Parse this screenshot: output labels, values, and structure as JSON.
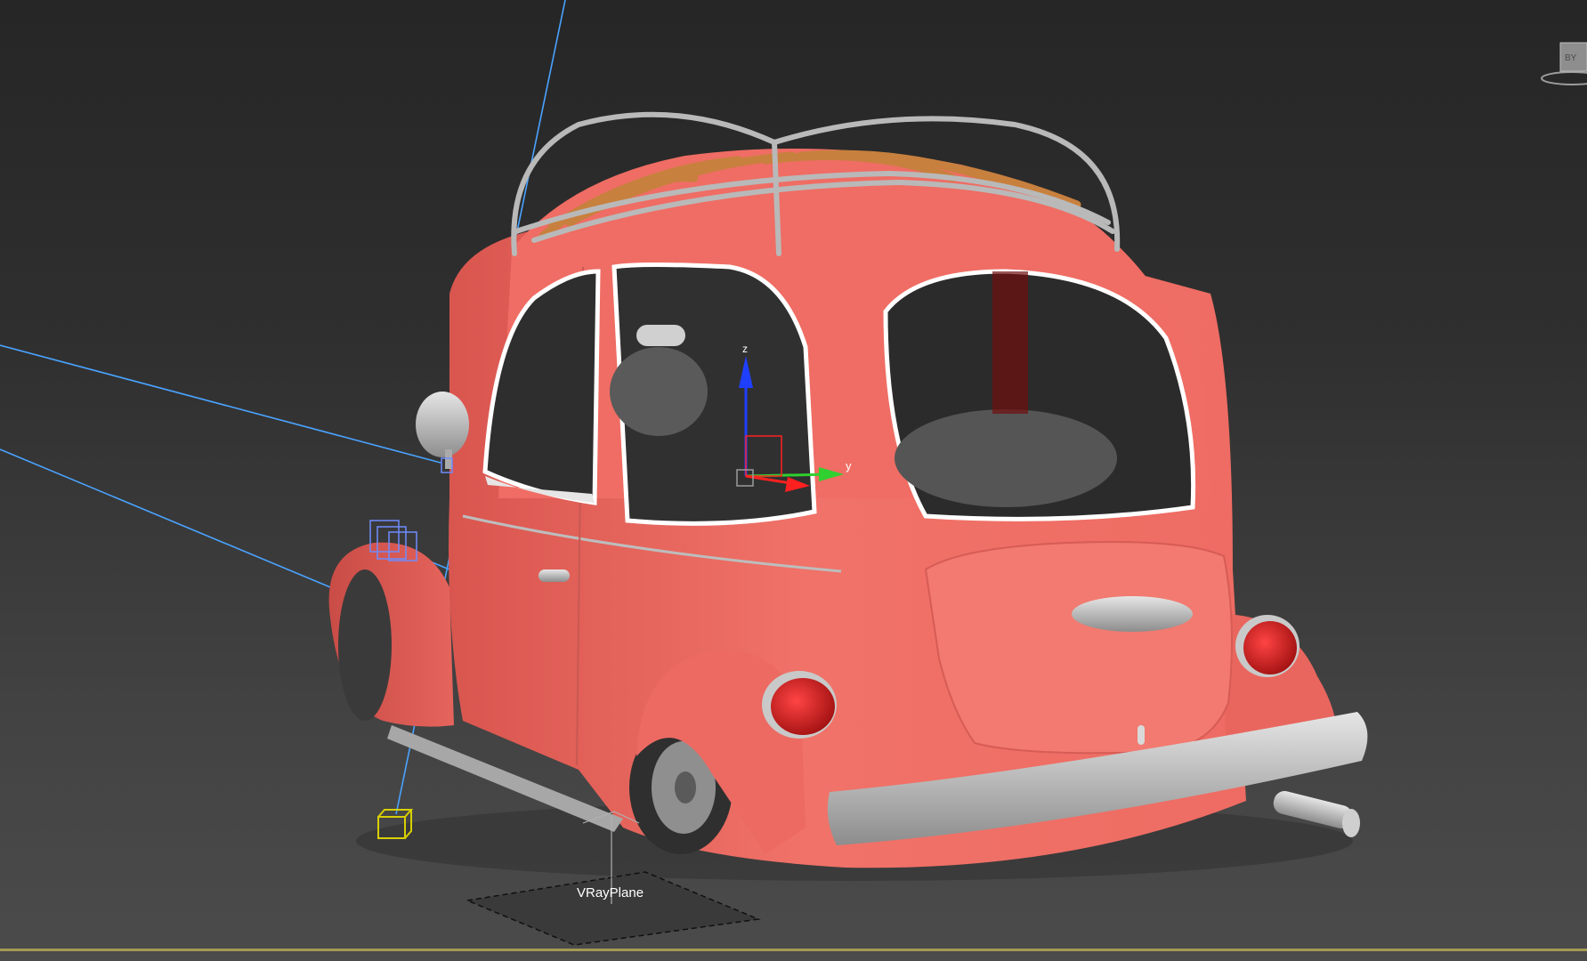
{
  "viewport": {
    "background_top": "#262626",
    "background_bottom": "#4b4b4b",
    "bottom_edge_color": "#a49a52"
  },
  "scene": {
    "car_body_color": "#f07268",
    "roof_slats_color": "#c8803e",
    "chrome_color": "#bdbdbd",
    "selection_line_color": "#4aa3ff",
    "helper_color": "#d8d000"
  },
  "gizmo": {
    "axis_z_label": "z",
    "axis_y_label": "y",
    "axis_z_color": "#1f3fff",
    "axis_y_color": "#2fd02f",
    "axis_x_color": "#ff2020"
  },
  "vray_plane": {
    "label": "VRayPlane"
  },
  "viewcube": {
    "face_label": "BY"
  }
}
